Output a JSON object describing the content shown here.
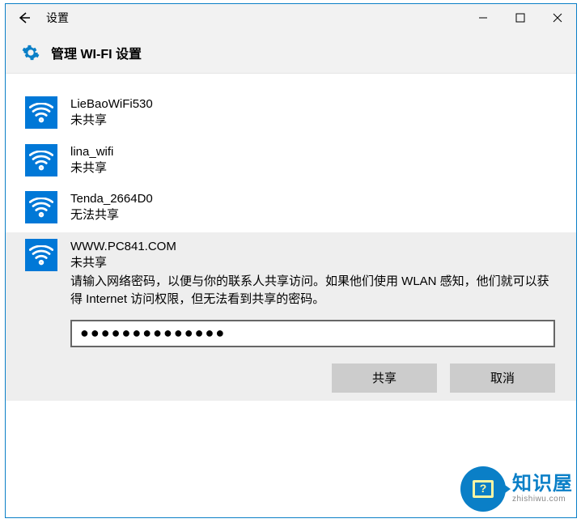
{
  "titlebar": {
    "title": "设置"
  },
  "page": {
    "title": "管理 WI-FI 设置"
  },
  "networks": [
    {
      "ssid": "LieBaoWiFi530",
      "status": "未共享"
    },
    {
      "ssid": "lina_wifi",
      "status": "未共享"
    },
    {
      "ssid": "Tenda_2664D0",
      "status": "无法共享"
    }
  ],
  "selected": {
    "ssid": "WWW.PC841.COM",
    "status": "未共享",
    "hint": "请输入网络密码，以便与你的联系人共享访问。如果他们使用 WLAN 感知，他们就可以获得 Internet 访问权限，但无法看到共享的密码。",
    "password_value": "●●●●●●●●●●●●●●",
    "share_label": "共享",
    "cancel_label": "取消"
  },
  "logo": {
    "brand_cn": "知识屋",
    "url": "zhishiwu.com"
  }
}
